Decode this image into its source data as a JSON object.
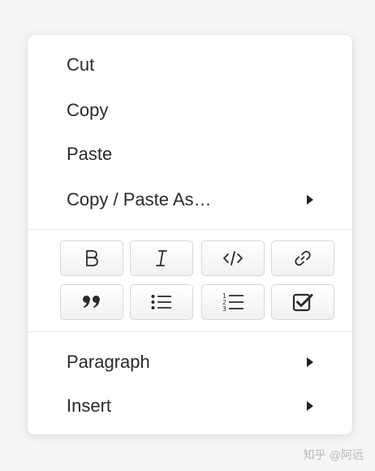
{
  "menu": {
    "items_top": [
      {
        "label": "Cut"
      },
      {
        "label": "Copy"
      },
      {
        "label": "Paste"
      },
      {
        "label": "Copy / Paste As…"
      }
    ],
    "format_buttons": [
      {
        "icon": "bold-icon"
      },
      {
        "icon": "italic-icon"
      },
      {
        "icon": "code-icon"
      },
      {
        "icon": "link-icon"
      },
      {
        "icon": "quote-icon"
      },
      {
        "icon": "bullet-list-icon"
      },
      {
        "icon": "numbered-list-icon"
      },
      {
        "icon": "checkbox-icon"
      }
    ],
    "items_bottom": [
      {
        "label": "Paragraph"
      },
      {
        "label": "Insert"
      }
    ]
  },
  "watermark": "知乎 @阿远",
  "colors": {
    "background": "#f5f5f5",
    "menu_bg": "#ffffff",
    "text": "#2b2b2b",
    "button_border": "#d8d8d8"
  }
}
